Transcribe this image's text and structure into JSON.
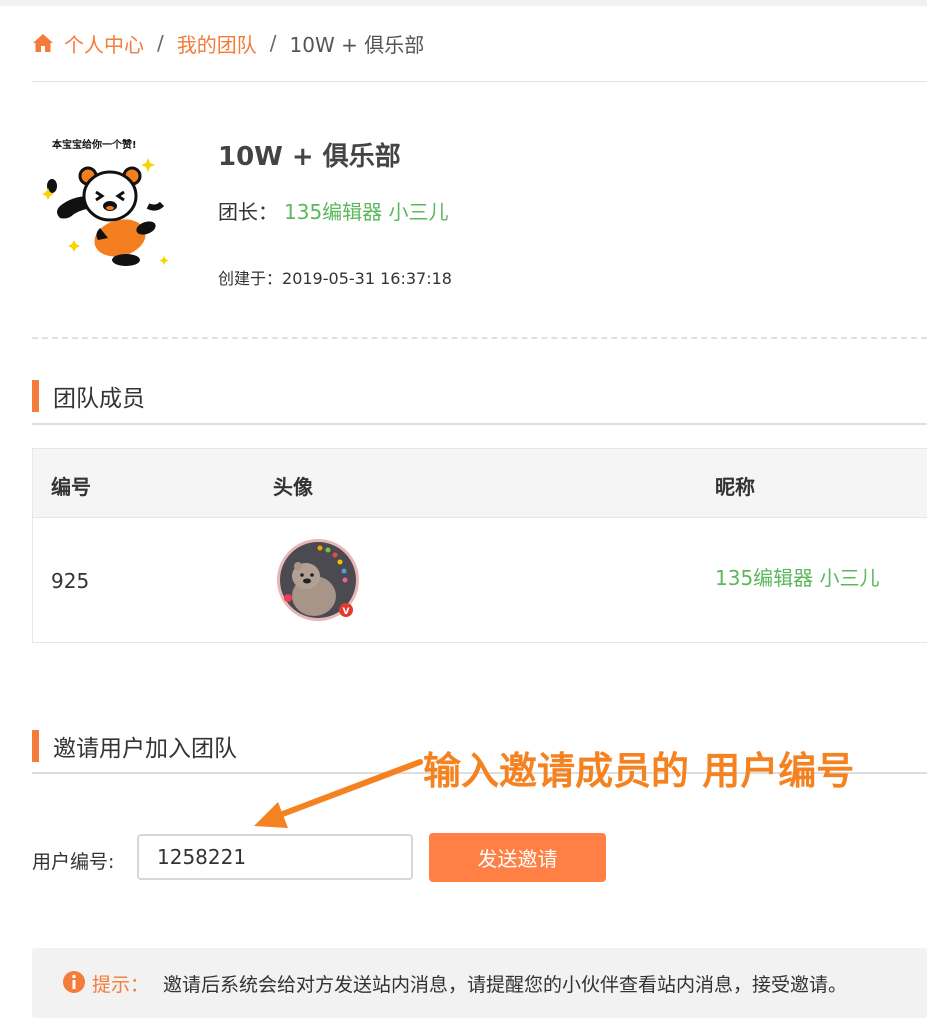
{
  "breadcrumb": {
    "home_icon": "home-icon",
    "item1": "个人中心",
    "item2": "我的团队",
    "current": "10W + 俱乐部",
    "separator": "/"
  },
  "team": {
    "mascot_caption": "本宝宝给你一个赞!",
    "name": "10W + 俱乐部",
    "leader_label": "团长：",
    "leader_name": "135编辑器 小三儿",
    "created_label": "创建于：",
    "created_at": "2019-05-31 16:37:18"
  },
  "members_section": {
    "title": "团队成员",
    "columns": [
      "编号",
      "头像",
      "昵称"
    ],
    "rows": [
      {
        "id": "925",
        "avatar": "bear-avatar",
        "nickname": "135编辑器 小三儿"
      }
    ]
  },
  "invite_section": {
    "title": "邀请用户加入团队",
    "field_label": "用户编号:",
    "field_value": "1258221",
    "button_label": "发送邀请",
    "annotation": "输入邀请成员的 用户编号"
  },
  "tip": {
    "icon": "info-icon",
    "label": "提示：",
    "message": "邀请后系统会给对方发送站内消息，请提醒您的小伙伴查看站内消息，接受邀请。"
  },
  "colors": {
    "accent": "#f47b3a",
    "link_green": "#5cb85c",
    "button": "#ff7f45",
    "annotation": "#f58220"
  }
}
